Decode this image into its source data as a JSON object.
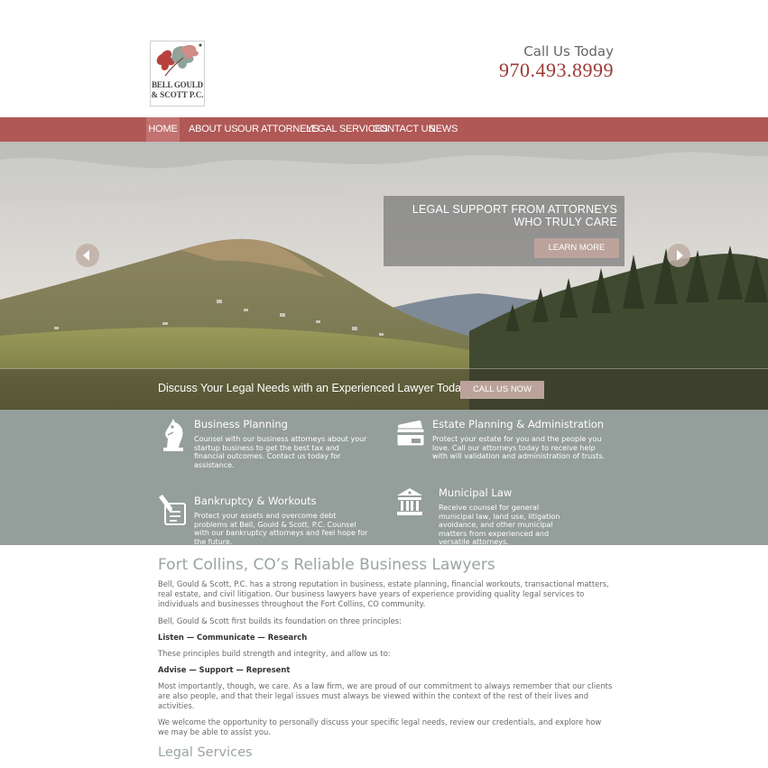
{
  "header": {
    "logo_line1": "BELL GOULD",
    "logo_line2": "& SCOTT P.C.",
    "call_label": "Call Us Today",
    "phone": "970.493.8999"
  },
  "nav": {
    "items": [
      "HOME",
      "ABOUT US",
      "OUR ATTORNEYS",
      "LEGAL SERVICES",
      "CONTACT US",
      "NEWS"
    ],
    "active": "HOME"
  },
  "hero": {
    "title": "LEGAL SUPPORT FROM ATTORNEYS WHO TRULY CARE",
    "learn_more": "LEARN MORE",
    "cta_text": "Discuss Your Legal Needs with an Experienced Lawyer Today",
    "cta_button": "CALL US NOW"
  },
  "services": [
    {
      "title": "Business Planning",
      "desc": "Counsel with our business attorneys about your startup business to get the best tax and financial outcomes. Contact us today for assistance.",
      "icon": "chess-knight-icon"
    },
    {
      "title": "Estate Planning & Administration",
      "desc": "Protect your estate for you and the people you love. Call our attorneys today to receive help with will validation and administration of trusts.",
      "icon": "credit-card-icon"
    },
    {
      "title": "Bankruptcy & Workouts",
      "desc": "Protect your assets and overcome debt problems at Bell, Gould & Scott, P.C. Counsel with our bankruptcy attorneys and feel hope for the future.",
      "icon": "document-pen-icon"
    },
    {
      "title": "Municipal Law",
      "desc": "Receive counsel for general municipal law, land use, litigation avoidance, and other municipal matters from experienced and versatile attorneys.",
      "icon": "municipal-building-icon"
    }
  ],
  "content": {
    "heading": "Fort Collins, CO’s Reliable Business Lawyers",
    "p1": "Bell, Gould & Scott, P.C. has a strong reputation in business, estate planning, financial workouts, transactional matters, real estate, and civil litigation. Our business lawyers have years of experience providing quality legal services to individuals and businesses throughout the Fort Collins, CO community.",
    "p2": "Bell, Gould & Scott first builds its foundation on three principles:",
    "p3": "Listen — Communicate — Research",
    "p4": "These principles build strength and integrity, and allow us to:",
    "p5": "Advise — Support — Represent",
    "p6": "Most importantly, though, we care. As a law firm, we are proud of our commitment to always remember that our clients are also people, and that their legal issues must always be viewed within the context of the rest of their lives and activities.",
    "p7": "We welcome the opportunity to personally discuss your specific legal needs, review our credentials, and explore how we may be able to assist you.",
    "subheading": "Legal Services"
  },
  "colors": {
    "nav": "#b05856",
    "phone": "#9c3a37",
    "services_band": "#949e9a",
    "button": "#bba39b",
    "heading": "#9aa5a1"
  }
}
